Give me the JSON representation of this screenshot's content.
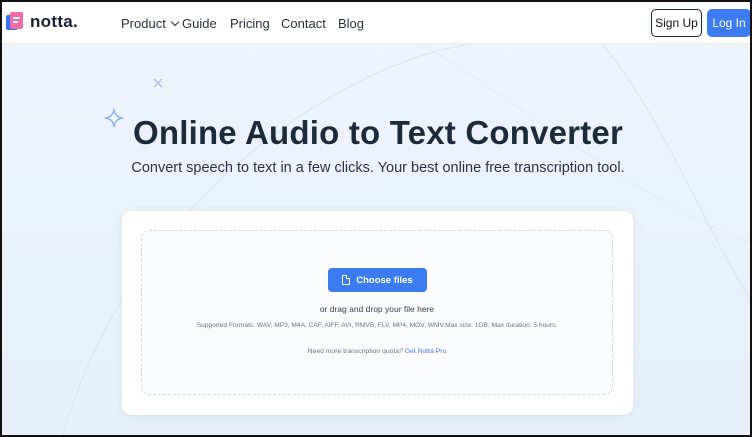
{
  "header": {
    "logo_text": "notta.",
    "nav": [
      {
        "label": "Product",
        "has_dropdown": true
      },
      {
        "label": "Guide"
      },
      {
        "label": "Pricing"
      },
      {
        "label": "Contact"
      },
      {
        "label": "Blog"
      }
    ],
    "signup_label": "Sign Up",
    "login_label": "Log In"
  },
  "hero": {
    "title": "Online Audio to Text Converter",
    "subtitle": "Convert speech to text in a few clicks. Your best online free transcription tool."
  },
  "upload": {
    "choose_label": "Choose files",
    "drag_text": "or drag and drop your file here",
    "formats_text": "Supported Formats: WAV, MP3, M4A, CAF, AIFF, AVI, RMVB, FLV, MP4, MOV, WMV.Max size: 1GB; Max duration: 5 hours.",
    "quota_text": "Need more transcription quota?",
    "quota_link": "Get Notta Pro"
  },
  "colors": {
    "accent": "#3d7bf2",
    "logo_blue": "#3b6ff5",
    "logo_pink": "#f06aa8",
    "background": "#eef4fb"
  }
}
